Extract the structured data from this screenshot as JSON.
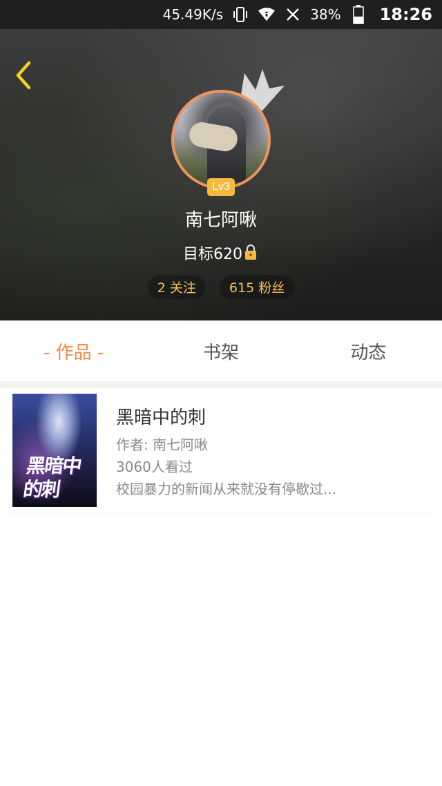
{
  "status_bar": {
    "speed": "45.49K/s",
    "battery": "38%",
    "time": "18:26",
    "icons": [
      "vibrate-icon",
      "wifi-icon",
      "no-sim-icon",
      "battery-icon"
    ]
  },
  "profile": {
    "username": "南七阿啾",
    "level": "Lv3",
    "goal": "目标620",
    "following": "2 关注",
    "fans": "615 粉丝"
  },
  "tabs": [
    {
      "label": "- 作品 -",
      "active": true
    },
    {
      "label": "书架",
      "active": false
    },
    {
      "label": "动态",
      "active": false
    }
  ],
  "books": [
    {
      "title": "黑暗中的刺",
      "author": "作者: 南七阿啾",
      "views": "3060人看过",
      "description": "校园暴力的新闻从来就没有停歇过..."
    }
  ],
  "colors": {
    "accent": "#ef8a4b",
    "stat_text": "#f3c35a",
    "badge": "#f5b93e",
    "back_arrow": "#f4d21e"
  }
}
